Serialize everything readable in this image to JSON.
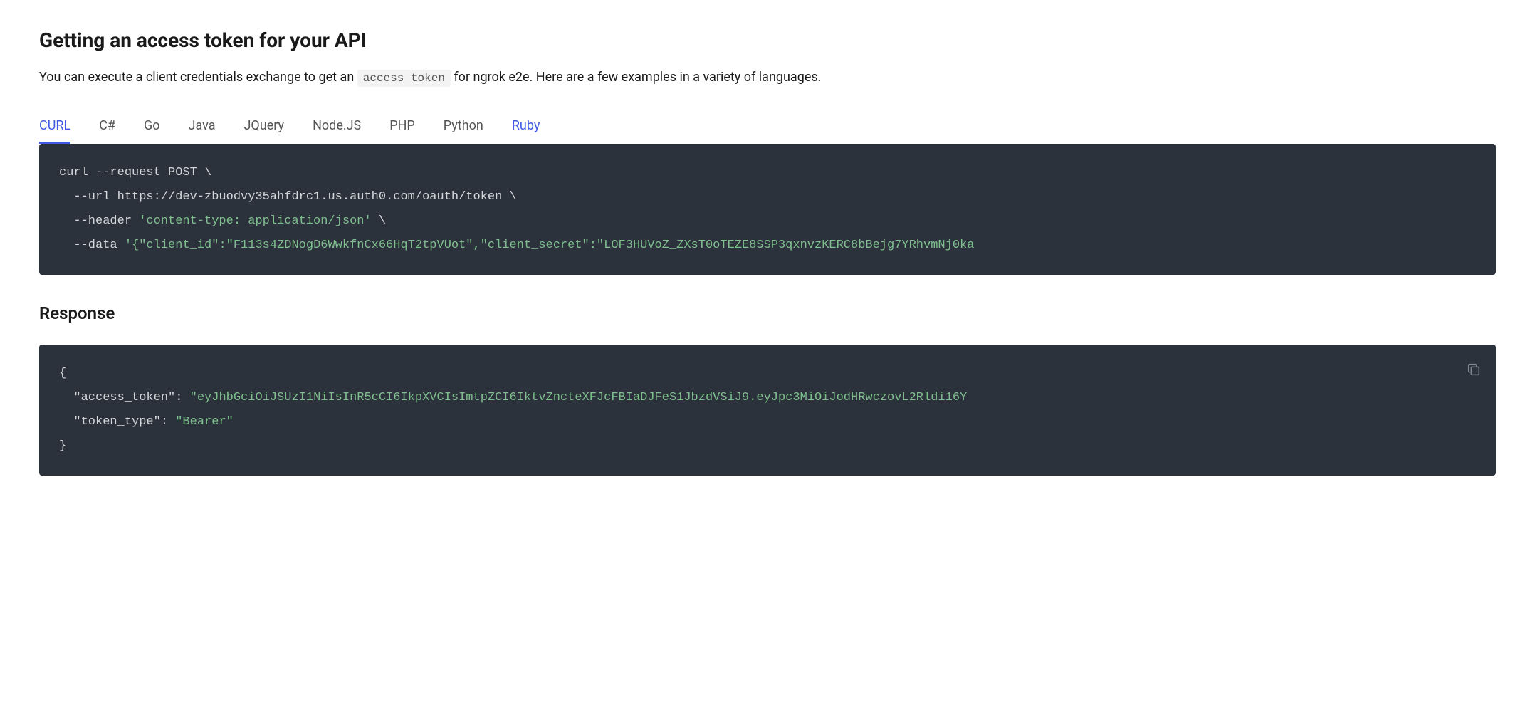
{
  "heading": "Getting an access token for your API",
  "description_pre": "You can execute a client credentials exchange to get an ",
  "description_inline_code": "access token",
  "description_post": " for ngrok e2e. Here are a few examples in a variety of languages.",
  "tabs": [
    {
      "label": "CURL",
      "active": true,
      "link": false
    },
    {
      "label": "C#",
      "active": false,
      "link": false
    },
    {
      "label": "Go",
      "active": false,
      "link": false
    },
    {
      "label": "Java",
      "active": false,
      "link": false
    },
    {
      "label": "JQuery",
      "active": false,
      "link": false
    },
    {
      "label": "Node.JS",
      "active": false,
      "link": false
    },
    {
      "label": "PHP",
      "active": false,
      "link": false
    },
    {
      "label": "Python",
      "active": false,
      "link": false
    },
    {
      "label": "Ruby",
      "active": false,
      "link": true
    }
  ],
  "code_request": {
    "line1": "curl --request POST \\",
    "line2": "  --url https://dev-zbuodvy35ahfdrc1.us.auth0.com/oauth/token \\",
    "line3_pre": "  --header ",
    "line3_str": "'content-type: application/json'",
    "line3_post": " \\",
    "line4_pre": "  --data ",
    "line4_str": "'{\"client_id\":\"F113s4ZDNogD6WwkfnCx66HqT2tpVUot\",\"client_secret\":\"LOF3HUVoZ_ZXsT0oTEZE8SSP3qxnvzKERC8bBejg7YRhvmNj0ka"
  },
  "response_heading": "Response",
  "code_response": {
    "line1": "{",
    "line2_pre": "  \"access_token\": ",
    "line2_str": "\"eyJhbGciOiJSUzI1NiIsInR5cCI6IkpXVCIsImtpZCI6IktvZncteXFJcFBIaDJFeS1JbzdVSiJ9.eyJpc3MiOiJodHRwczovL2Rldi16Y",
    "line3_pre": "  \"token_type\": ",
    "line3_str": "\"Bearer\"",
    "line4": "}"
  }
}
